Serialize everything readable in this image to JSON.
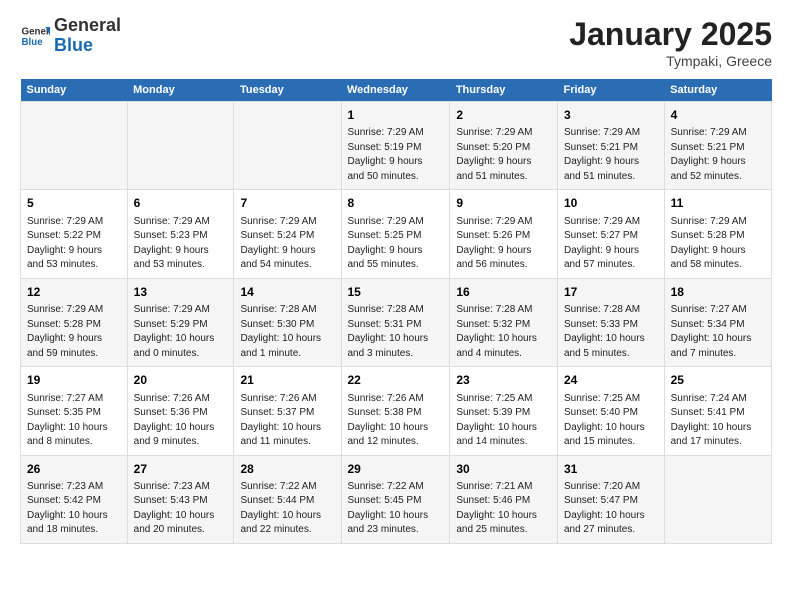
{
  "header": {
    "logo_general": "General",
    "logo_blue": "Blue",
    "title": "January 2025",
    "subtitle": "Tympaki, Greece"
  },
  "days_of_week": [
    "Sunday",
    "Monday",
    "Tuesday",
    "Wednesday",
    "Thursday",
    "Friday",
    "Saturday"
  ],
  "weeks": [
    [
      {
        "date": "",
        "content": ""
      },
      {
        "date": "",
        "content": ""
      },
      {
        "date": "",
        "content": ""
      },
      {
        "date": "1",
        "content": "Sunrise: 7:29 AM\nSunset: 5:19 PM\nDaylight: 9 hours\nand 50 minutes."
      },
      {
        "date": "2",
        "content": "Sunrise: 7:29 AM\nSunset: 5:20 PM\nDaylight: 9 hours\nand 51 minutes."
      },
      {
        "date": "3",
        "content": "Sunrise: 7:29 AM\nSunset: 5:21 PM\nDaylight: 9 hours\nand 51 minutes."
      },
      {
        "date": "4",
        "content": "Sunrise: 7:29 AM\nSunset: 5:21 PM\nDaylight: 9 hours\nand 52 minutes."
      }
    ],
    [
      {
        "date": "5",
        "content": "Sunrise: 7:29 AM\nSunset: 5:22 PM\nDaylight: 9 hours\nand 53 minutes."
      },
      {
        "date": "6",
        "content": "Sunrise: 7:29 AM\nSunset: 5:23 PM\nDaylight: 9 hours\nand 53 minutes."
      },
      {
        "date": "7",
        "content": "Sunrise: 7:29 AM\nSunset: 5:24 PM\nDaylight: 9 hours\nand 54 minutes."
      },
      {
        "date": "8",
        "content": "Sunrise: 7:29 AM\nSunset: 5:25 PM\nDaylight: 9 hours\nand 55 minutes."
      },
      {
        "date": "9",
        "content": "Sunrise: 7:29 AM\nSunset: 5:26 PM\nDaylight: 9 hours\nand 56 minutes."
      },
      {
        "date": "10",
        "content": "Sunrise: 7:29 AM\nSunset: 5:27 PM\nDaylight: 9 hours\nand 57 minutes."
      },
      {
        "date": "11",
        "content": "Sunrise: 7:29 AM\nSunset: 5:28 PM\nDaylight: 9 hours\nand 58 minutes."
      }
    ],
    [
      {
        "date": "12",
        "content": "Sunrise: 7:29 AM\nSunset: 5:28 PM\nDaylight: 9 hours\nand 59 minutes."
      },
      {
        "date": "13",
        "content": "Sunrise: 7:29 AM\nSunset: 5:29 PM\nDaylight: 10 hours\nand 0 minutes."
      },
      {
        "date": "14",
        "content": "Sunrise: 7:28 AM\nSunset: 5:30 PM\nDaylight: 10 hours\nand 1 minute."
      },
      {
        "date": "15",
        "content": "Sunrise: 7:28 AM\nSunset: 5:31 PM\nDaylight: 10 hours\nand 3 minutes."
      },
      {
        "date": "16",
        "content": "Sunrise: 7:28 AM\nSunset: 5:32 PM\nDaylight: 10 hours\nand 4 minutes."
      },
      {
        "date": "17",
        "content": "Sunrise: 7:28 AM\nSunset: 5:33 PM\nDaylight: 10 hours\nand 5 minutes."
      },
      {
        "date": "18",
        "content": "Sunrise: 7:27 AM\nSunset: 5:34 PM\nDaylight: 10 hours\nand 7 minutes."
      }
    ],
    [
      {
        "date": "19",
        "content": "Sunrise: 7:27 AM\nSunset: 5:35 PM\nDaylight: 10 hours\nand 8 minutes."
      },
      {
        "date": "20",
        "content": "Sunrise: 7:26 AM\nSunset: 5:36 PM\nDaylight: 10 hours\nand 9 minutes."
      },
      {
        "date": "21",
        "content": "Sunrise: 7:26 AM\nSunset: 5:37 PM\nDaylight: 10 hours\nand 11 minutes."
      },
      {
        "date": "22",
        "content": "Sunrise: 7:26 AM\nSunset: 5:38 PM\nDaylight: 10 hours\nand 12 minutes."
      },
      {
        "date": "23",
        "content": "Sunrise: 7:25 AM\nSunset: 5:39 PM\nDaylight: 10 hours\nand 14 minutes."
      },
      {
        "date": "24",
        "content": "Sunrise: 7:25 AM\nSunset: 5:40 PM\nDaylight: 10 hours\nand 15 minutes."
      },
      {
        "date": "25",
        "content": "Sunrise: 7:24 AM\nSunset: 5:41 PM\nDaylight: 10 hours\nand 17 minutes."
      }
    ],
    [
      {
        "date": "26",
        "content": "Sunrise: 7:23 AM\nSunset: 5:42 PM\nDaylight: 10 hours\nand 18 minutes."
      },
      {
        "date": "27",
        "content": "Sunrise: 7:23 AM\nSunset: 5:43 PM\nDaylight: 10 hours\nand 20 minutes."
      },
      {
        "date": "28",
        "content": "Sunrise: 7:22 AM\nSunset: 5:44 PM\nDaylight: 10 hours\nand 22 minutes."
      },
      {
        "date": "29",
        "content": "Sunrise: 7:22 AM\nSunset: 5:45 PM\nDaylight: 10 hours\nand 23 minutes."
      },
      {
        "date": "30",
        "content": "Sunrise: 7:21 AM\nSunset: 5:46 PM\nDaylight: 10 hours\nand 25 minutes."
      },
      {
        "date": "31",
        "content": "Sunrise: 7:20 AM\nSunset: 5:47 PM\nDaylight: 10 hours\nand 27 minutes."
      },
      {
        "date": "",
        "content": ""
      }
    ]
  ]
}
